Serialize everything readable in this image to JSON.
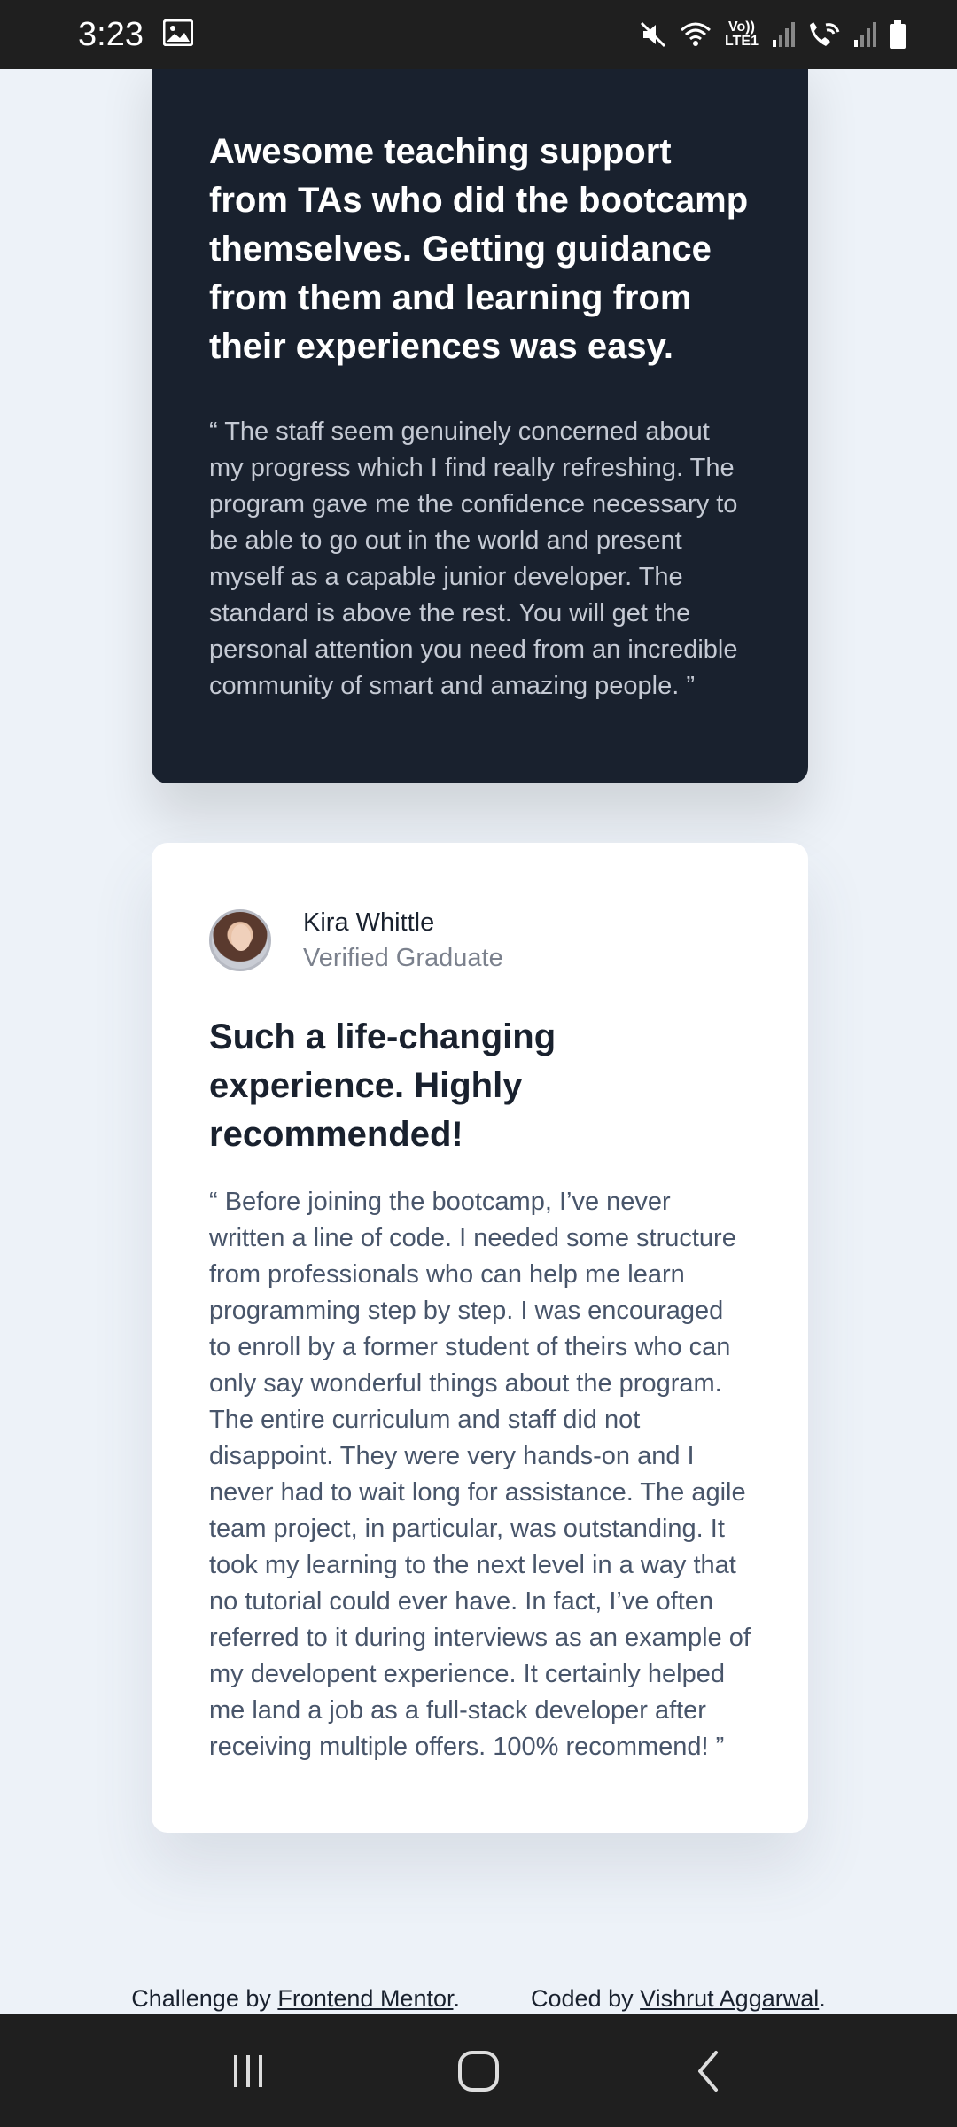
{
  "status_bar": {
    "time": "3:23",
    "lte_label": "Vo)) LTE1",
    "icons": [
      "image-icon",
      "mute-icon",
      "wifi-icon",
      "signal-icon",
      "wifi-call-icon",
      "signal-icon",
      "battery-icon"
    ]
  },
  "testimonial_dark": {
    "headline": "Awesome teaching support from TAs who did the bootcamp themselves. Getting guidance from them and learning from their experiences was easy.",
    "quote": "“ The staff seem genuinely concerned about my progress which I find really refreshing. The program gave me the confidence necessary to be able to go out in the world and present myself as a capable junior developer. The standard is above the rest. You will get the personal attention you need from an incredible community of smart and amazing people. ”"
  },
  "testimonial_white": {
    "author_name": "Kira Whittle",
    "author_role": "Verified Graduate",
    "headline": "Such a life-changing experience. Highly recommended!",
    "quote": "“ Before joining the bootcamp, I’ve never written a line of code. I needed some structure from professionals who can help me learn programming step by step. I was encouraged to enroll by a former student of theirs who can only say wonderful things about the program. The entire curriculum and staff did not disappoint. They were very hands-on and I never had to wait long for assistance. The agile team project, in particular, was outstanding. It took my learning to the next level in a way that no tutorial could ever have. In fact, I’ve often referred to it during interviews as an example of my developent experience. It certainly helped me land a job as a full-stack developer after receiving multiple offers. 100% recommend! ”"
  },
  "footer": {
    "challenge_prefix": "Challenge by ",
    "challenge_link": "Frontend Mentor",
    "coded_prefix": "Coded by ",
    "coded_link": "Vishrut Aggarwal",
    "period": "."
  },
  "nav_bar": {
    "buttons": [
      "recents-button",
      "home-button",
      "back-button"
    ]
  },
  "colors": {
    "background": "#edf2f8",
    "dark_card": "#19212e",
    "white_card": "#ffffff",
    "body_text": "#48556a"
  }
}
